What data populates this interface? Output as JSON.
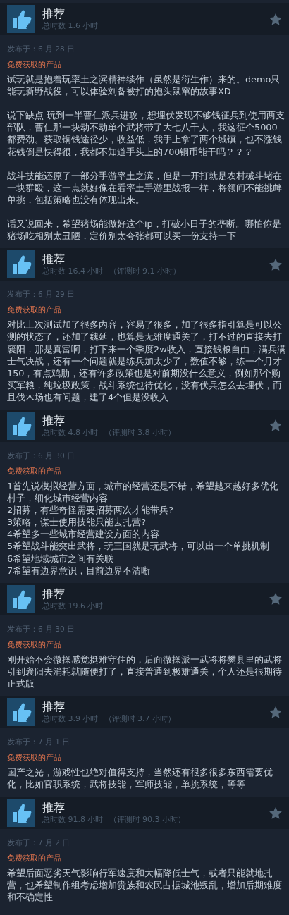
{
  "reviews": [
    {
      "verdict": "推荐",
      "total_hours": "总时数 1.6 小时",
      "date": "发布于：6 月 28 日",
      "tag": "免费获取的产品",
      "blank_line_between": true,
      "paragraphs": [
        "试玩就是抱着玩率土之滨精神续作（虽然是衍生作）来的。demo只能玩新野战役，可以体验刘备被打的抱头鼠窜的故事XD",
        "说下缺点 玩到一半曹仁派兵进攻，想埋伏发现不够钱征兵到使用两支部队，曹仁那一块动不动单个武将带了大七八千人，我这征个5000都费劲。获取铜钱途径少，收益低，我手上拿了两个城镇，也不涨钱花钱倒是快得很，我都不知道手头上的700铜币能干吗？？？",
        "战斗技能还原了一部分手游率土之滨，但是一开打就是农村械斗堵在一块群殴，这一点就好像在看率土手游里战报一样，将领间不能挑衅单挑，包括策略也没有体现出来。",
        "话又说回来，希望猪场能做好这个ip，打破小日子的垄断。哪怕你是猪场吃相别太丑陋，定价别太夸张都可以买一份支持一下"
      ]
    },
    {
      "verdict": "推荐",
      "total_hours": "总时数 16.4 小时",
      "review_hours": "（评测时 9.1 小时）",
      "date": "发布于：6 月 29 日",
      "tag": "免费获取的产品",
      "paragraphs": [
        "对比上次测试加了很多内容，容易了很多，加了很多指引算是可以公测的状态了，还加了魏延，也算是无难度通关了，打不过的直接去打襄阳，那是真富啊，打下来一个季度2w收入，直接钱粮自由，满兵满士气决战，还有一个问题就是练兵加太少了，数值不够，练一个月才150，有点鸡肋，还有许多政策也是对前期没什么意义，例如那个购买军粮，纯垃圾政策，战斗系统也待优化，没有伏兵怎么去埋伏，而且伐木场也有问题，建了4个但是没收入"
      ]
    },
    {
      "verdict": "推荐",
      "total_hours": "总时数 4.8 小时",
      "review_hours": "（评测时 3.8 小时）",
      "date": "发布于：6 月 30 日",
      "tag": "免费获取的产品",
      "blank_line_between": false,
      "paragraphs": [
        "1首先说模拟经营方面，城市的经营还是不错，希望越来越好多优化村子，细化城市经营内容",
        "2招募，有些奇怪需要招募两次才能带兵?",
        "3策略，谋士使用技能只能去扎营?",
        "4希望多一些城市经营建设方面的内容",
        "5希望战斗能突出武将，玩三国就是玩武将，可以出一个单挑机制",
        "6希望地域城市之间有关联",
        "7希望有边界意识，目前边界不清晰"
      ]
    },
    {
      "verdict": "推荐",
      "total_hours": "总时数 19.6 小时",
      "date": "发布于：6 月 30 日",
      "tag": "免费获取的产品",
      "paragraphs": [
        "刚开始不会微操感觉挺难守住的，后面微操派一武将将樊县里的武将引到襄阳去消耗就随便打了，直接普通到极难通关，个人还是很期待正式版"
      ]
    },
    {
      "verdict": "推荐",
      "total_hours": "总时数 3.9 小时",
      "review_hours": "（评测时 3.7 小时）",
      "date": "发布于：7 月 1 日",
      "tag": "免费获取的产品",
      "paragraphs": [
        "国产之光，游戏性也绝对值得支持，当然还有很多很多东西需要优化，比如官职系统，武将技能，军师技能，单挑系统，等等"
      ]
    },
    {
      "verdict": "推荐",
      "total_hours": "总时数 91.8 小时",
      "review_hours": "（评测时 90.3 小时）",
      "date": "发布于：7 月 2 日",
      "tag": "免费获取的产品",
      "paragraphs": [
        "希望后面恶劣天气影响行军速度和大幅降低士气，或者只能就地扎营，也希望制作组考虑增加贵族和农民占据城池叛乱，增加后期难度和不确定性"
      ]
    }
  ]
}
